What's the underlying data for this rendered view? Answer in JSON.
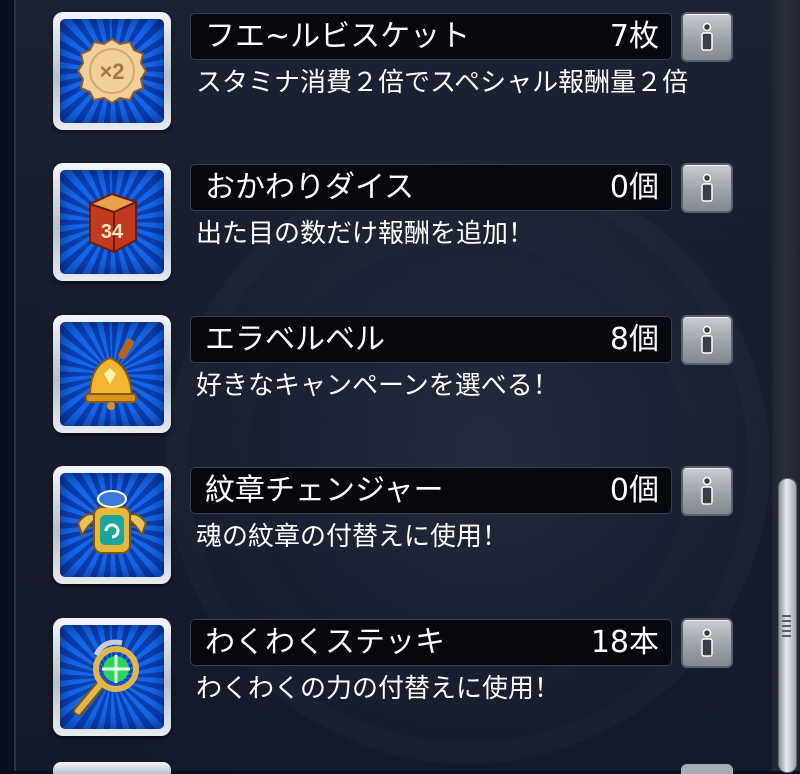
{
  "items": [
    {
      "name": "フエ~ルビスケット",
      "count": "7枚",
      "desc": "スタミナ消費２倍でスペシャル報酬量２倍",
      "icon": "biscuit-icon",
      "icon_label": "×2"
    },
    {
      "name": "おかわりダイス",
      "count": "0個",
      "desc": "出た目の数だけ報酬を追加！",
      "icon": "dice-icon",
      "icon_label": "34"
    },
    {
      "name": "エラベルベル",
      "count": "8個",
      "desc": "好きなキャンペーンを選べる！",
      "icon": "bell-icon"
    },
    {
      "name": "紋章チェンジャー",
      "count": "0個",
      "desc": "魂の紋章の付替えに使用！",
      "icon": "crest-changer-icon"
    },
    {
      "name": "わくわくステッキ",
      "count": "18本",
      "desc": "わくわくの力の付替えに使用！",
      "icon": "wand-icon"
    }
  ],
  "info_button_icon": "info-icon",
  "colors": {
    "icon_bg": "#1667e8",
    "name_bar": "#06080d",
    "text": "#ffffff"
  }
}
